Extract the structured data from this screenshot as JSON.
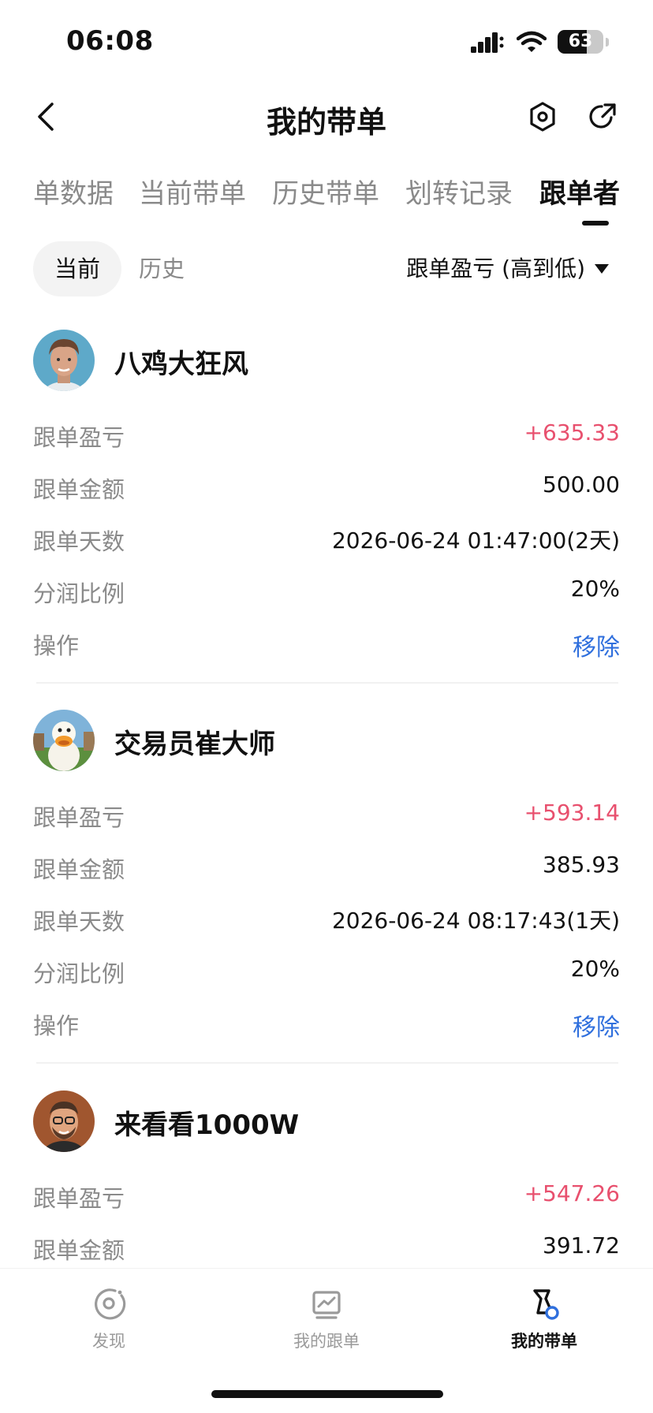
{
  "status_bar": {
    "time": "06:08",
    "battery": "63"
  },
  "nav": {
    "title": "我的带单",
    "back_icon": "chevron-left-icon",
    "settings_icon": "hexagon-settings-icon",
    "share_icon": "share-arrow-icon"
  },
  "main_tabs": [
    "单数据",
    "当前带单",
    "历史带单",
    "划转记录",
    "跟单者"
  ],
  "active_main_tab": 4,
  "sub_tabs": {
    "current": "当前",
    "history": "历史"
  },
  "sort": {
    "label": "跟单盈亏 (高到低)"
  },
  "labels": {
    "pnl": "跟单盈亏",
    "amount": "跟单金额",
    "days": "跟单天数",
    "share": "分润比例",
    "operation": "操作"
  },
  "followers": [
    {
      "name": "八鸡大狂风",
      "pnl": "+635.33",
      "amount": "500.00",
      "days": "2026-06-24 01:47:00(2天)",
      "share": "20%",
      "action": "移除"
    },
    {
      "name": "交易员崔大师",
      "pnl": "+593.14",
      "amount": "385.93",
      "days": "2026-06-24 08:17:43(1天)",
      "share": "20%",
      "action": "移除"
    },
    {
      "name": "来看看1000W",
      "pnl": "+547.26",
      "amount": "391.72"
    }
  ],
  "bottom_nav": [
    {
      "label": "发现",
      "icon": "discover-icon"
    },
    {
      "label": "我的跟单",
      "icon": "chart-icon"
    },
    {
      "label": "我的带单",
      "icon": "lead-trade-icon"
    }
  ],
  "colors": {
    "profit": "#e8506e",
    "action": "#2f6fdd",
    "muted": "#8a8a8a",
    "text": "#111111"
  }
}
